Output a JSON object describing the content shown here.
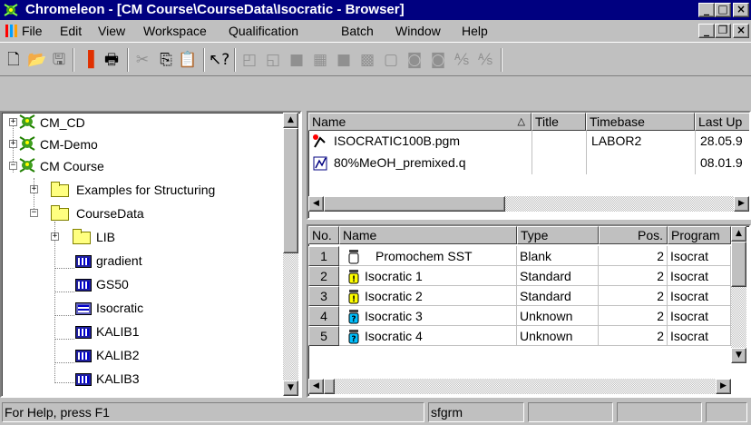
{
  "window": {
    "title": "Chromeleon - [CM Course\\CourseData\\Isocratic - Browser]"
  },
  "menu": {
    "items": [
      "File",
      "Edit",
      "View",
      "Workspace",
      "Qualification",
      "Batch",
      "Window",
      "Help"
    ]
  },
  "tree": {
    "items": [
      {
        "label": "CM_CD",
        "type": "server",
        "expander": "+"
      },
      {
        "label": "CM-Demo",
        "type": "server",
        "expander": "+"
      },
      {
        "label": "CM Course",
        "type": "server",
        "expander": "-"
      },
      {
        "label": "Examples for Structuring",
        "type": "folder",
        "expander": "+"
      },
      {
        "label": "CourseData",
        "type": "folder",
        "expander": "-"
      },
      {
        "label": "LIB",
        "type": "folder",
        "expander": "+"
      },
      {
        "label": "gradient",
        "type": "sequence"
      },
      {
        "label": "GS50",
        "type": "sequence"
      },
      {
        "label": "Isocratic",
        "type": "sequence-open"
      },
      {
        "label": "KALIB1",
        "type": "sequence"
      },
      {
        "label": "KALIB2",
        "type": "sequence"
      },
      {
        "label": "KALIB3",
        "type": "sequence"
      }
    ]
  },
  "files": {
    "headers": [
      "Name",
      "Title",
      "Timebase",
      "Last Up"
    ],
    "rows": [
      {
        "name": "ISOCRATIC100B.pgm",
        "title": "",
        "timebase": "LABOR2",
        "last": "28.05.9"
      },
      {
        "name": "80%MeOH_premixed.q",
        "title": "",
        "timebase": "",
        "last": "08.01.9"
      }
    ]
  },
  "samples": {
    "headers": [
      "No.",
      "Name",
      "Type",
      "Pos.",
      "Program"
    ],
    "rows": [
      {
        "no": "1",
        "name": "Promochem SST",
        "type": "Blank",
        "pos": "2",
        "program": "Isocrat",
        "icon": "blank"
      },
      {
        "no": "2",
        "name": "Isocratic 1",
        "type": "Standard",
        "pos": "2",
        "program": "Isocrat",
        "icon": "standard"
      },
      {
        "no": "3",
        "name": "Isocratic 2",
        "type": "Standard",
        "pos": "2",
        "program": "Isocrat",
        "icon": "standard"
      },
      {
        "no": "4",
        "name": "Isocratic 3",
        "type": "Unknown",
        "pos": "2",
        "program": "Isocrat",
        "icon": "unknown"
      },
      {
        "no": "5",
        "name": "Isocratic 4",
        "type": "Unknown",
        "pos": "2",
        "program": "Isocrat",
        "icon": "unknown"
      }
    ]
  },
  "status": {
    "help": "For Help, press F1",
    "user": "sfgrm"
  }
}
